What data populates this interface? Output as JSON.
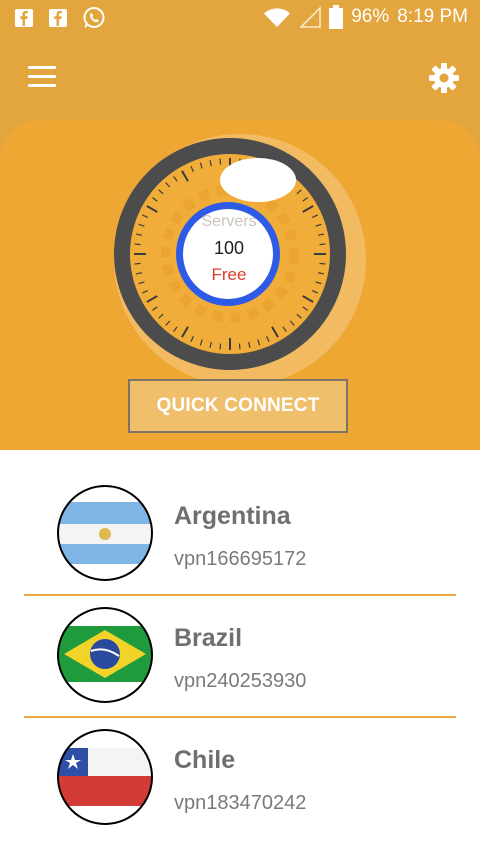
{
  "status_bar": {
    "battery": "96%",
    "time": "8:19 PM",
    "icons_left": [
      "facebook-icon",
      "facebook-icon",
      "whatsapp-icon"
    ],
    "icons_right": [
      "wifi-icon",
      "signal-icon",
      "battery-icon"
    ]
  },
  "app_bar": {
    "menu_icon": "hamburger-menu-icon",
    "settings_icon": "gear-icon"
  },
  "dial": {
    "label": "Servers",
    "count": "100",
    "plan": "Free"
  },
  "quick_connect": {
    "label": "QUICK CONNECT"
  },
  "servers": [
    {
      "country": "Argentina",
      "server": "vpn166695172"
    },
    {
      "country": "Brazil",
      "server": "vpn240253930"
    },
    {
      "country": "Chile",
      "server": "vpn183470242"
    }
  ],
  "colors": {
    "primary": "#e3a53d",
    "hero": "#efa734",
    "divider": "#e6a640",
    "free_text": "#e13a2a",
    "ring_blue": "#2d5ae6",
    "dial_dark": "#4c4c4c"
  }
}
